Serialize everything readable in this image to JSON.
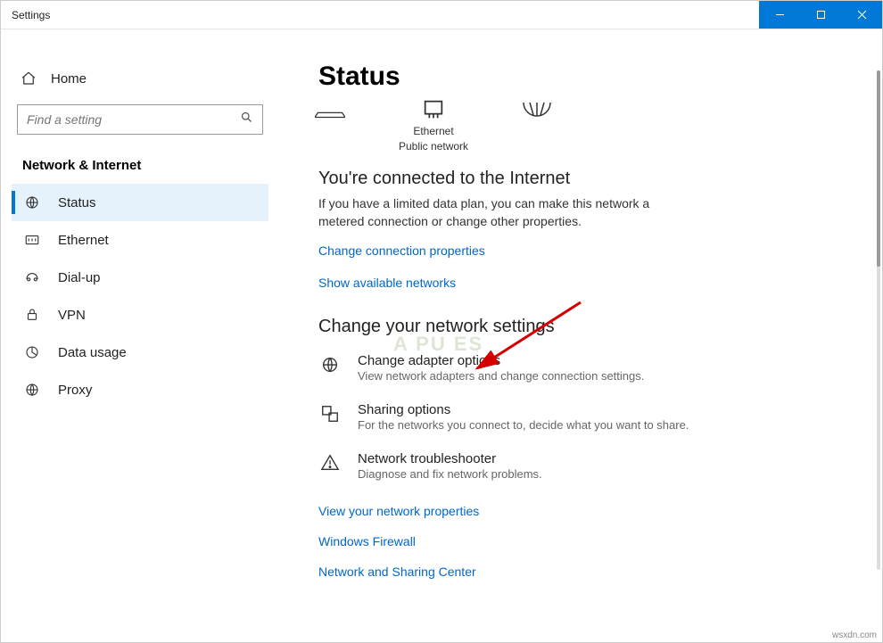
{
  "window": {
    "title": "Settings"
  },
  "sidebar": {
    "home_label": "Home",
    "search_placeholder": "Find a setting",
    "category": "Network & Internet",
    "items": [
      {
        "label": "Status"
      },
      {
        "label": "Ethernet"
      },
      {
        "label": "Dial-up"
      },
      {
        "label": "VPN"
      },
      {
        "label": "Data usage"
      },
      {
        "label": "Proxy"
      }
    ]
  },
  "content": {
    "title": "Status",
    "net_icon_label": "Ethernet",
    "net_icon_sub": "Public network",
    "connected_heading": "You're connected to the Internet",
    "connected_text": "If you have a limited data plan, you can make this network a metered connection or change other properties.",
    "link_conn_props": "Change connection properties",
    "link_show_nets": "Show available networks",
    "change_heading": "Change your network settings",
    "options": [
      {
        "title": "Change adapter options",
        "desc": "View network adapters and change connection settings."
      },
      {
        "title": "Sharing options",
        "desc": "For the networks you connect to, decide what you want to share."
      },
      {
        "title": "Network troubleshooter",
        "desc": "Diagnose and fix network problems."
      }
    ],
    "links_bottom": [
      "View your network properties",
      "Windows Firewall",
      "Network and Sharing Center"
    ]
  },
  "watermark": "A  PU  ES",
  "credit": "wsxdn.com"
}
